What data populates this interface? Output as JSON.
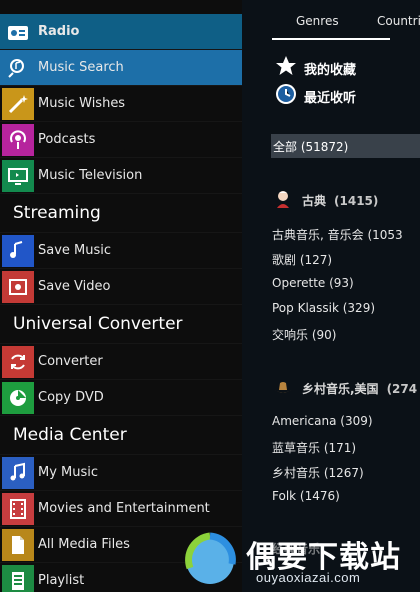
{
  "sidebar": {
    "items": [
      {
        "id": "radio",
        "label": "Radio",
        "icon": "radio-icon"
      },
      {
        "id": "music_search",
        "label": "Music Search",
        "icon": "search-note-icon"
      },
      {
        "id": "music_wishes",
        "label": "Music Wishes",
        "icon": "magic-wand-icon"
      },
      {
        "id": "podcasts",
        "label": "Podcasts",
        "icon": "podcast-icon"
      },
      {
        "id": "music_television",
        "label": "Music Television",
        "icon": "tv-icon"
      }
    ],
    "streaming": {
      "heading": "Streaming",
      "items": [
        {
          "id": "save_music",
          "label": "Save Music",
          "icon": "save-music-icon"
        },
        {
          "id": "save_video",
          "label": "Save Video",
          "icon": "save-video-icon"
        }
      ]
    },
    "converter": {
      "heading": "Universal Converter",
      "items": [
        {
          "id": "converter",
          "label": "Converter",
          "icon": "converter-icon"
        },
        {
          "id": "copy_dvd",
          "label": "Copy DVD",
          "icon": "dvd-icon"
        }
      ]
    },
    "media_center": {
      "heading": "Media Center",
      "items": [
        {
          "id": "my_music",
          "label": "My Music",
          "icon": "music-note-icon"
        },
        {
          "id": "movies",
          "label": "Movies and Entertainment",
          "icon": "film-icon"
        },
        {
          "id": "all_media",
          "label": "All Media Files",
          "icon": "file-icon"
        },
        {
          "id": "playlist",
          "label": "Playlist",
          "icon": "playlist-icon"
        }
      ]
    }
  },
  "main": {
    "tabs": [
      {
        "label": "Genres"
      },
      {
        "label": "Countri"
      }
    ],
    "favorites": [
      {
        "label": "我的收藏",
        "icon": "star-icon"
      },
      {
        "label": "最近收听",
        "icon": "clock-icon"
      }
    ],
    "all": {
      "label": "全部 (51872)"
    },
    "classical": {
      "title": "古典",
      "count": "(1415)",
      "icon": "composer-icon",
      "items": [
        "古典音乐,  音乐会 (1053",
        "歌剧 (127)",
        "Operette (93)",
        "Pop Klassik (329)",
        "交响乐 (90)"
      ]
    },
    "country": {
      "title": "乡村音乐,美国",
      "count": "(274",
      "icon": "cowboy-hat-icon",
      "items": [
        "Americana (309)",
        "蓝草音乐 (171)",
        "乡村音乐 (1267)",
        "Folk (1476)"
      ]
    },
    "partial": {
      "text": "经典音乐"
    }
  },
  "watermark": {
    "title": "偶要下载站",
    "subtitle": "ouyaoxiazai.com"
  },
  "colors": {
    "selected": "#1d6fa8",
    "sidebar": "#0d0d0d",
    "main": "#0b1117"
  }
}
